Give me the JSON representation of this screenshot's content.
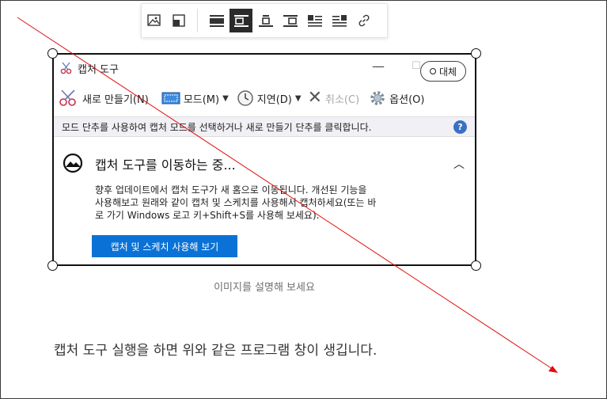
{
  "editor_toolbar": {
    "buttons": [
      {
        "name": "image-edit-icon",
        "active": false
      },
      {
        "name": "image-resize-icon",
        "active": false
      },
      {
        "name": "align-wide-icon",
        "active": false
      },
      {
        "name": "align-left-icon",
        "active": true
      },
      {
        "name": "align-center-icon",
        "active": false
      },
      {
        "name": "align-right-icon",
        "active": false
      },
      {
        "name": "wrap-left-icon",
        "active": false
      },
      {
        "name": "wrap-right-icon",
        "active": false
      },
      {
        "name": "link-icon",
        "active": false
      }
    ]
  },
  "snip_window": {
    "title": "캡처 도구",
    "alt_button": "대체",
    "toolbar": {
      "new": "새로 만들기(N)",
      "mode": "모드(M)",
      "delay": "지연(D)",
      "cancel": "취소(C)",
      "options": "옵션(O)"
    },
    "hint": "모드 단추를 사용하여 캡처 모드를 선택하거나 새로 만들기 단추를 클릭합니다.",
    "notice_title": "캡처 도구를 이동하는 중...",
    "notice_body_1": "향후 업데이트에서 캡처 도구가 새 홈으로 이동됩니다. 개선된 기능을",
    "notice_body_2": "사용해보고 원래와 같이 캡처 및 스케치를 사용해서 캡처하세요(또는 바",
    "notice_body_3": "로 가기 Windows 로고 키+Shift+S를 사용해 보세요).",
    "notice_button": "캡처 및 스케치 사용해 보기"
  },
  "caption_placeholder": "이미지를 설명해 보세요",
  "paragraph": "캡처 도구 실행을 하면 위와 같은 프로그램 창이 생깁니다.",
  "colors": {
    "accent_button": "#0a72d6",
    "arrow": "#e01010",
    "hint_bar": "#f0f0f5"
  }
}
